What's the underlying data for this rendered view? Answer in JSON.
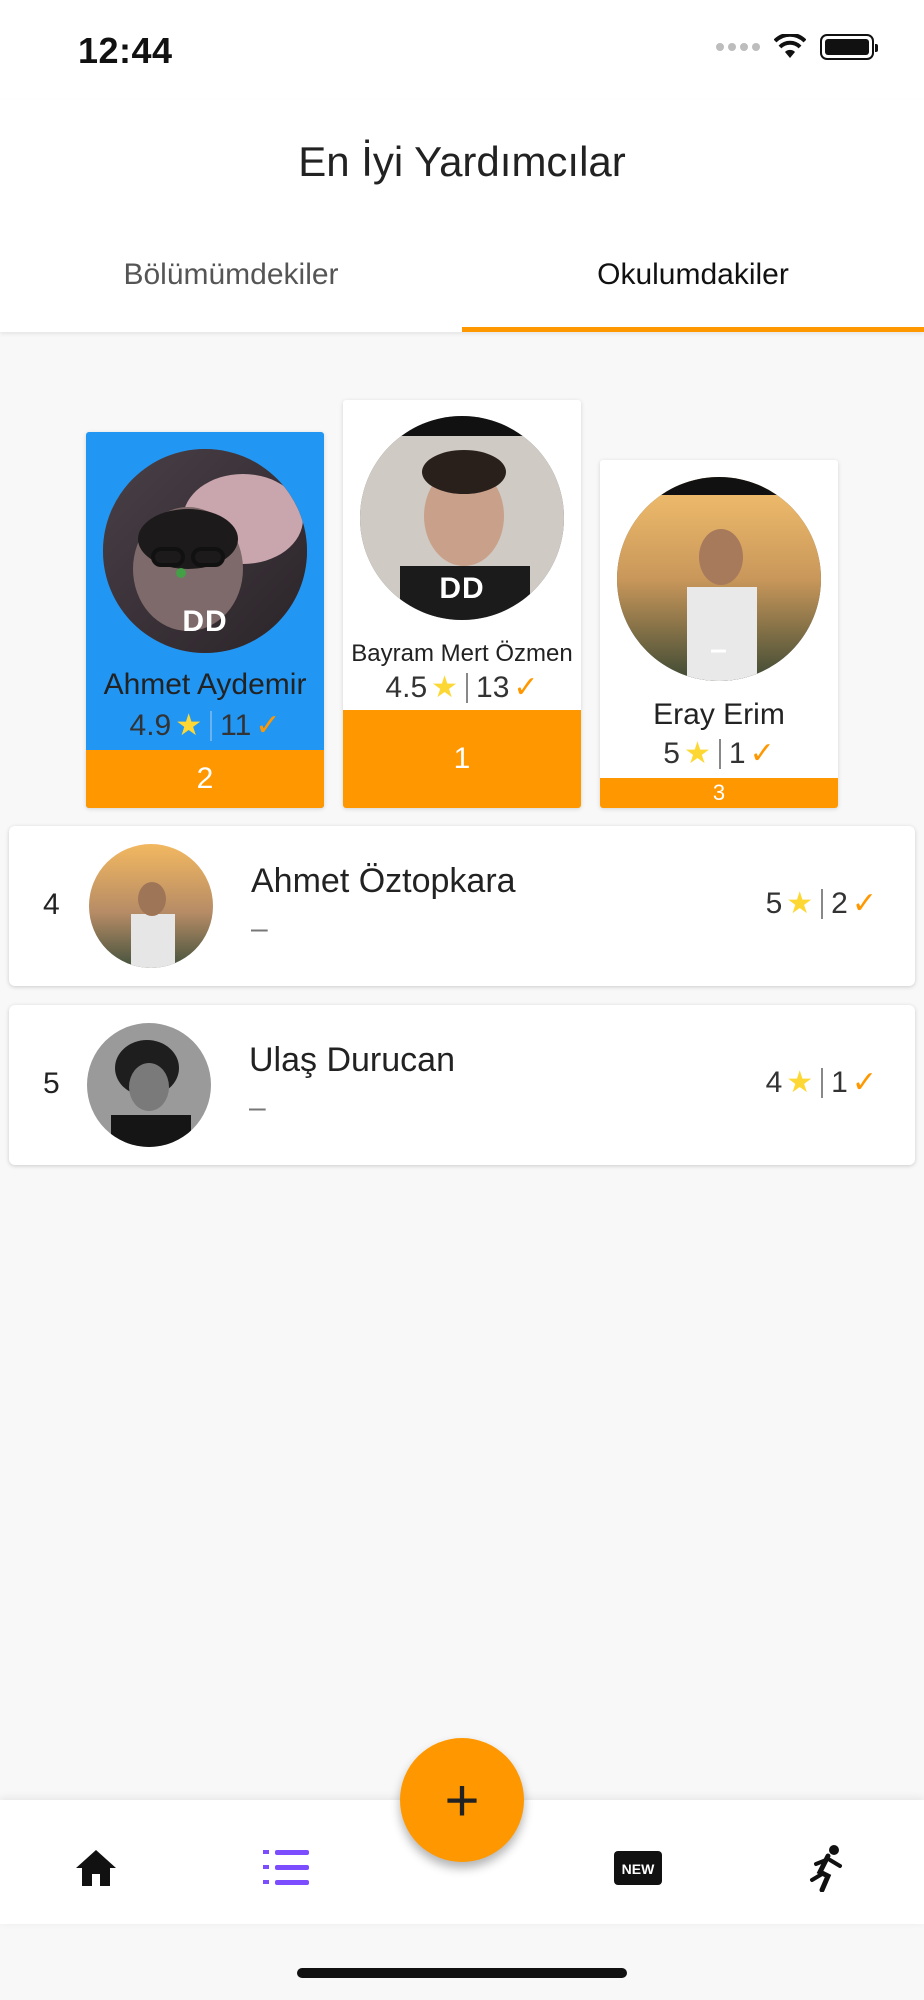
{
  "status_bar": {
    "time": "12:44"
  },
  "header": {
    "title": "En İyi Yardımcılar"
  },
  "tabs": [
    {
      "label": "Bölümümdekiler",
      "active": false
    },
    {
      "label": "Okulumdakiler",
      "active": true
    }
  ],
  "podium": [
    {
      "name": "Ahmet Aydemir",
      "rating": "4.9",
      "helps": "11",
      "rank": "2",
      "avatar_overlay": "DD",
      "highlighted": true
    },
    {
      "name": "Bayram Mert Özmen",
      "rating": "4.5",
      "helps": "13",
      "rank": "1",
      "avatar_overlay": "DD",
      "highlighted": false
    },
    {
      "name": "Eray Erim",
      "rating": "5",
      "helps": "1",
      "rank": "3",
      "avatar_overlay": "–",
      "highlighted": false
    }
  ],
  "list": [
    {
      "rank": "4",
      "name": "Ahmet Öztopkara",
      "subtitle": "–",
      "rating": "5",
      "helps": "2"
    },
    {
      "rank": "5",
      "name": "Ulaş Durucan",
      "subtitle": "–",
      "rating": "4",
      "helps": "1"
    }
  ],
  "fab": {
    "label": "+"
  },
  "bottom_nav": [
    {
      "icon": "home-icon",
      "active": false
    },
    {
      "icon": "ranking-list-icon",
      "active": true
    },
    {
      "icon": "new-badge-icon",
      "active": false
    },
    {
      "icon": "running-person-icon",
      "active": false
    }
  ],
  "colors": {
    "accent": "#ff9800",
    "highlight": "#2196f3",
    "star": "#fdd835",
    "nav_active": "#7c4dff"
  }
}
